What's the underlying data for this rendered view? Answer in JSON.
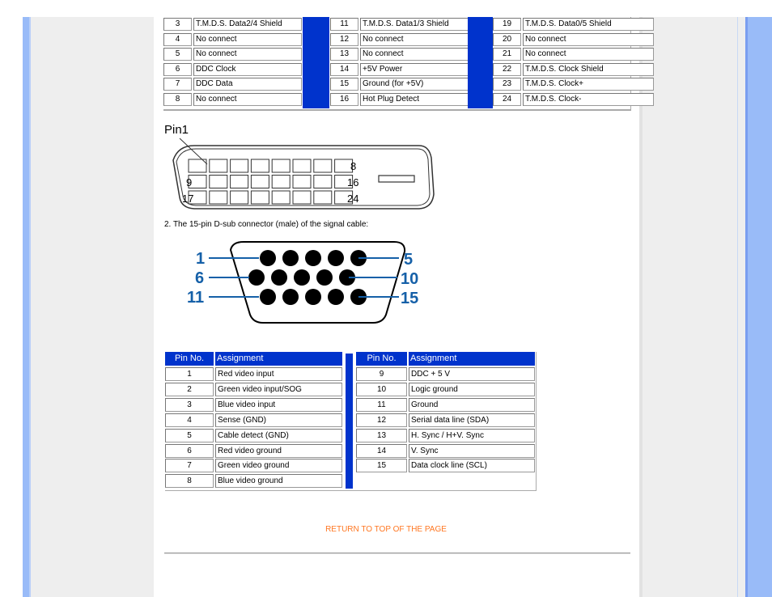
{
  "colors": {
    "accent_blue": "#0033cc",
    "side_blue": "#99bbf8",
    "side_grey": "#eeeeee",
    "link_orange": "#ff7722",
    "dsub_label_blue": "#1560a8"
  },
  "dvi_table": {
    "columns": [
      {
        "rows": [
          {
            "pin": "3",
            "assignment": "T.M.D.S. Data2/4 Shield"
          },
          {
            "pin": "4",
            "assignment": "No connect"
          },
          {
            "pin": "5",
            "assignment": "No connect"
          },
          {
            "pin": "6",
            "assignment": "DDC Clock"
          },
          {
            "pin": "7",
            "assignment": "DDC Data"
          },
          {
            "pin": "8",
            "assignment": "No connect"
          }
        ]
      },
      {
        "rows": [
          {
            "pin": "11",
            "assignment": "T.M.D.S. Data1/3 Shield"
          },
          {
            "pin": "12",
            "assignment": "No connect"
          },
          {
            "pin": "13",
            "assignment": "No connect"
          },
          {
            "pin": "14",
            "assignment": "+5V Power"
          },
          {
            "pin": "15",
            "assignment": "Ground (for +5V)"
          },
          {
            "pin": "16",
            "assignment": "Hot Plug Detect"
          }
        ]
      },
      {
        "rows": [
          {
            "pin": "19",
            "assignment": "T.M.D.S. Data0/5 Shield"
          },
          {
            "pin": "20",
            "assignment": "No connect"
          },
          {
            "pin": "21",
            "assignment": "No connect"
          },
          {
            "pin": "22",
            "assignment": "T.M.D.S. Clock Shield"
          },
          {
            "pin": "23",
            "assignment": "T.M.D.S. Clock+"
          },
          {
            "pin": "24",
            "assignment": "T.M.D.S. Clock-"
          }
        ]
      }
    ]
  },
  "dvi_diagram": {
    "pin1_label": "Pin1",
    "labels": {
      "row1_end": "8",
      "row2_start": "9",
      "row2_end": "16",
      "row3_start": "17",
      "row3_end": "24"
    }
  },
  "dsub": {
    "caption": "2. The 15-pin D-sub connector (male) of the signal cable:",
    "labels": {
      "p1": "1",
      "p5": "5",
      "p6": "6",
      "p10": "10",
      "p11": "11",
      "p15": "15"
    }
  },
  "vga_table": {
    "header": {
      "pin": "Pin No.",
      "assignment": "Assignment"
    },
    "left": [
      {
        "pin": "1",
        "assignment": "Red video input"
      },
      {
        "pin": "2",
        "assignment": "Green video input/SOG"
      },
      {
        "pin": "3",
        "assignment": "Blue video input"
      },
      {
        "pin": "4",
        "assignment": "Sense (GND)"
      },
      {
        "pin": "5",
        "assignment": "Cable detect (GND)"
      },
      {
        "pin": "6",
        "assignment": "Red video ground"
      },
      {
        "pin": "7",
        "assignment": "Green video ground"
      },
      {
        "pin": "8",
        "assignment": "Blue video ground"
      }
    ],
    "right": [
      {
        "pin": "9",
        "assignment": "DDC + 5 V"
      },
      {
        "pin": "10",
        "assignment": "Logic ground"
      },
      {
        "pin": "11",
        "assignment": "Ground"
      },
      {
        "pin": "12",
        "assignment": "Serial data line (SDA)"
      },
      {
        "pin": "13",
        "assignment": "H. Sync / H+V. Sync"
      },
      {
        "pin": "14",
        "assignment": "V. Sync"
      },
      {
        "pin": "15",
        "assignment": "Data clock line (SCL)"
      }
    ]
  },
  "footer": {
    "return_link": "RETURN TO TOP OF THE PAGE"
  }
}
